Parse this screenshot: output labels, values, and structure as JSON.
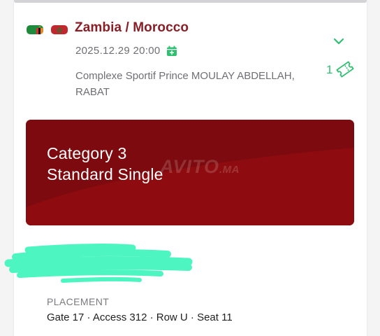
{
  "match": {
    "title": "Zambia / Morocco",
    "datetime": "2025.12.29 20:00",
    "venue": "Complexe Sportif Prince MOULAY ABDELLAH, RABAT",
    "ticket_count": "1"
  },
  "ticket": {
    "category": "Category 3",
    "type": "Standard Single"
  },
  "watermark": {
    "main": "AVITO",
    "suffix": ".MA"
  },
  "placement": {
    "label": "PLACEMENT",
    "value": "Gate 17 · Access 312 · Row U · Seat 11"
  },
  "colors": {
    "title": "#8a1e26",
    "banner": "#7d0a0e",
    "accent_green": "#2fbf71",
    "redaction": "#4df5c0"
  },
  "icons": {
    "flag_home": "zambia-flag-icon",
    "flag_away": "morocco-flag-icon",
    "calendar": "calendar-plus-icon",
    "expand": "chevron-down-icon",
    "ticket": "ticket-icon"
  }
}
